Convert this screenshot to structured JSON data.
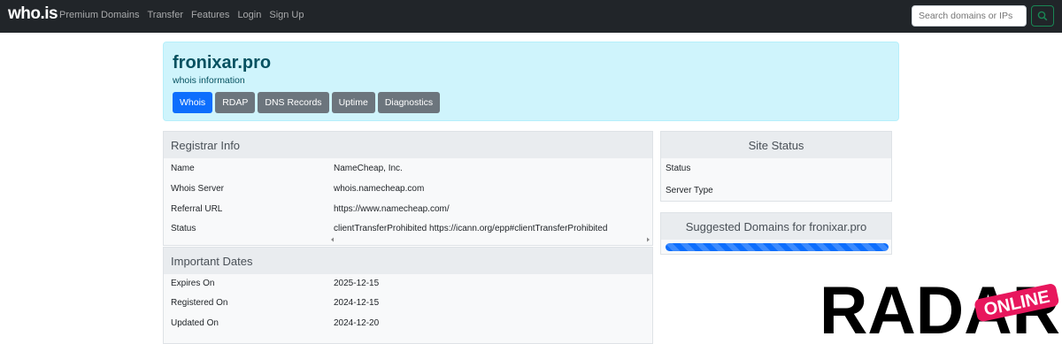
{
  "nav": {
    "brand": "who.is",
    "links": [
      "Premium Domains",
      "Transfer",
      "Features",
      "Login",
      "Sign Up"
    ],
    "search_placeholder": "Search domains or IPs"
  },
  "hero": {
    "title": "fronixar.pro",
    "subtitle": "whois information",
    "tabs": [
      "Whois",
      "RDAP",
      "DNS Records",
      "Uptime",
      "Diagnostics"
    ],
    "active_tab": "Whois"
  },
  "registrar": {
    "heading": "Registrar Info",
    "rows": [
      {
        "label": "Name",
        "value": "NameCheap, Inc."
      },
      {
        "label": "Whois Server",
        "value": "whois.namecheap.com"
      },
      {
        "label": "Referral URL",
        "value": "https://www.namecheap.com/"
      },
      {
        "label": "Status",
        "value": "clientTransferProhibited https://icann.org/epp#clientTransferProhibited"
      }
    ]
  },
  "dates": {
    "heading": "Important Dates",
    "rows": [
      {
        "label": "Expires On",
        "value": "2025-12-15"
      },
      {
        "label": "Registered On",
        "value": "2024-12-15"
      },
      {
        "label": "Updated On",
        "value": "2024-12-20"
      }
    ]
  },
  "site_status": {
    "heading": "Site Status",
    "rows": [
      {
        "label": "Status"
      },
      {
        "label": "Server Type"
      }
    ]
  },
  "suggested": {
    "heading": "Suggested Domains for fronixar.pro",
    "progress": 1.0
  },
  "watermark": {
    "main": "RADAR",
    "badge": "ONLINE"
  },
  "colors": {
    "nav_bg": "#212529",
    "hero_bg": "#cff4fc",
    "active_tab": "#0d6efd",
    "tab": "#6c757d",
    "badge": "#e8175d"
  }
}
